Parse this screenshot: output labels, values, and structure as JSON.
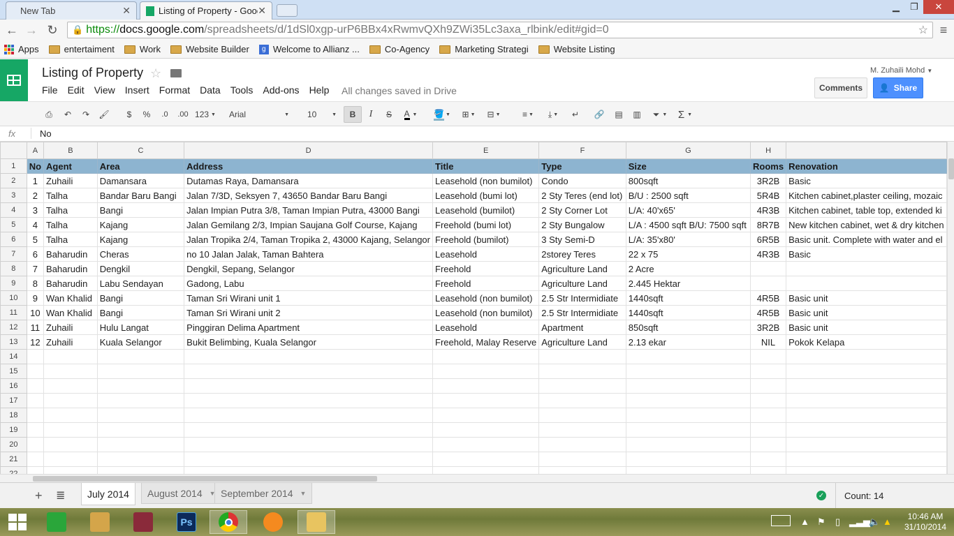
{
  "browser": {
    "tabs": [
      {
        "title": "New Tab"
      },
      {
        "title": "Listing of Property - Goog"
      }
    ],
    "url": {
      "scheme": "https://",
      "host": "docs.google.com",
      "path": "/spreadsheets/d/1dSl0xgp-urP6BBx4xRwmvQXh9ZWi35Lc3axa_rlbink/edit#gid=0"
    },
    "bookmarks": [
      {
        "label": "Apps",
        "icon": "apps-grid-icon"
      },
      {
        "label": "entertaiment",
        "icon": "folder-icon"
      },
      {
        "label": "Work",
        "icon": "folder-icon"
      },
      {
        "label": "Website Builder",
        "icon": "folder-icon"
      },
      {
        "label": "Welcome to Allianz ...",
        "icon": "google-icon"
      },
      {
        "label": "Co-Agency",
        "icon": "folder-icon"
      },
      {
        "label": "Marketing Strategi",
        "icon": "folder-icon"
      },
      {
        "label": "Website Listing",
        "icon": "folder-icon"
      }
    ]
  },
  "doc": {
    "title": "Listing of Property",
    "menu": [
      "File",
      "Edit",
      "View",
      "Insert",
      "Format",
      "Data",
      "Tools",
      "Add-ons",
      "Help"
    ],
    "save_status": "All changes saved in Drive",
    "user": "M. Zuhaili Mohd",
    "comments_label": "Comments",
    "share_label": "Share"
  },
  "toolbar": {
    "currency": "$",
    "percent": "%",
    "dec_decrease": ".0",
    "dec_increase": ".00",
    "more_formats": "123",
    "font": "Arial",
    "font_size": "10",
    "bold": "B",
    "italic": "I",
    "strike": "S",
    "text_color": "A"
  },
  "formula_bar": {
    "fx": "fx",
    "value": "No"
  },
  "grid": {
    "columns": [
      "A",
      "B",
      "C",
      "D",
      "E",
      "F",
      "G",
      "H",
      ""
    ],
    "header": [
      "No",
      "Agent",
      "Area",
      "Address",
      "Title",
      "Type",
      "Size",
      "Rooms",
      "Renovation"
    ],
    "rows": [
      [
        "1",
        "Zuhaili",
        "Damansara",
        "Dutamas Raya, Damansara",
        "Leasehold (non bumilot)",
        "Condo",
        "800sqft",
        "3R2B",
        "Basic"
      ],
      [
        "2",
        "Talha",
        "Bandar Baru Bangi",
        "Jalan 7/3D, Seksyen 7, 43650 Bandar Baru Bangi",
        "Leasehold (bumi lot)",
        "2 Sty Teres (end lot)",
        "B/U : 2500 sqft",
        "5R4B",
        "Kitchen cabinet,plaster ceiling, mozaic"
      ],
      [
        "3",
        "Talha",
        "Bangi",
        "Jalan Impian Putra 3/8, Taman Impian Putra, 43000 Bangi",
        "Leasehold (bumilot)",
        "2 Sty Corner Lot",
        "L/A: 40'x65'",
        "4R3B",
        "Kitchen cabinet, table top, extended ki"
      ],
      [
        "4",
        "Talha",
        "Kajang",
        "Jalan Gemilang 2/3, Impian Saujana Golf Course, Kajang",
        "Freehold (bumi lot)",
        "2 Sty Bungalow",
        "L/A : 4500 sqft B/U: 7500 sqft",
        "8R7B",
        "New kitchen cabinet, wet & dry kitchen"
      ],
      [
        "5",
        "Talha",
        "Kajang",
        "Jalan Tropika 2/4, Taman Tropika 2, 43000 Kajang, Selangor",
        "Freehold (bumilot)",
        "3 Sty Semi-D",
        "L/A: 35'x80'",
        "6R5B",
        "Basic unit. Complete with water and el"
      ],
      [
        "6",
        "Baharudin",
        "Cheras",
        "no 10 Jalan Jalak, Taman Bahtera",
        "Leasehold",
        "2storey Teres",
        "22 x 75",
        "4R3B",
        "Basic"
      ],
      [
        "7",
        "Baharudin",
        "Dengkil",
        "Dengkil, Sepang, Selangor",
        "Freehold",
        "Agriculture Land",
        "2 Acre",
        "",
        ""
      ],
      [
        "8",
        "Baharudin",
        "Labu Sendayan",
        "Gadong, Labu",
        "Freehold",
        "Agriculture Land",
        "2.445 Hektar",
        "",
        ""
      ],
      [
        "9",
        "Wan Khalid",
        "Bangi",
        "Taman Sri Wirani unit 1",
        "Leasehold (non bumilot)",
        "2.5 Str Intermidiate",
        "1440sqft",
        "4R5B",
        "Basic unit"
      ],
      [
        "10",
        "Wan Khalid",
        "Bangi",
        "Taman Sri Wirani unit 2",
        "Leasehold (non bumilot)",
        "2.5 Str Intermidiate",
        "1440sqft",
        "4R5B",
        "Basic unit"
      ],
      [
        "11",
        "Zuhaili",
        "Hulu Langat",
        "Pinggiran Delima Apartment",
        "Leasehold",
        "Apartment",
        "850sqft",
        "3R2B",
        "Basic unit"
      ],
      [
        "12",
        "Zuhaili",
        "Kuala Selangor",
        "Bukit Belimbing, Kuala Selangor",
        "Freehold, Malay Reserve",
        "Agriculture Land",
        "2.13 ekar",
        "NIL",
        "Pokok Kelapa"
      ]
    ],
    "row_numbers": [
      "1",
      "2",
      "3",
      "4",
      "5",
      "6",
      "7",
      "8",
      "9",
      "10",
      "11",
      "12",
      "13",
      "14",
      "15",
      "16",
      "17",
      "18",
      "19",
      "20",
      "21",
      "22"
    ]
  },
  "sheets": [
    {
      "name": "July 2014",
      "active": true
    },
    {
      "name": "August 2014",
      "active": false
    },
    {
      "name": "September 2014",
      "active": false
    }
  ],
  "status": {
    "count": "Count: 14"
  },
  "taskbar": {
    "time": "10:46 AM",
    "date": "31/10/2014"
  }
}
